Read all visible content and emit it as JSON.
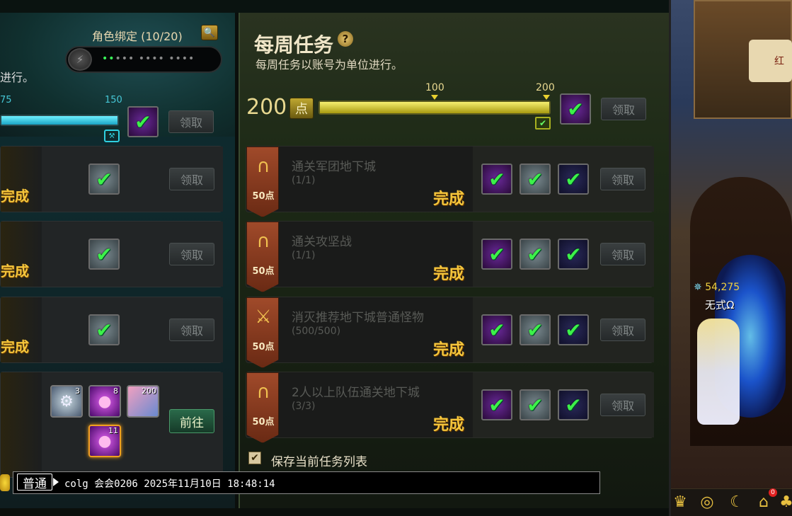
{
  "left": {
    "char_bind_label": "角色绑定 (10/20)",
    "pwd_masked": "••• •••• ••••",
    "pwd_active_dots": "••",
    "desc_fragment": "进行。",
    "tick_75": "75",
    "tick_150": "150",
    "progress": 1.0,
    "claim_label": "领取",
    "go_label": "前往",
    "done_label": "完成",
    "items": [
      {
        "count": "3",
        "icon": "gear-shield-icon"
      },
      {
        "count": "8",
        "icon": "purple-orb-icon"
      },
      {
        "count": "200",
        "icon": "ticket-icon"
      },
      {
        "count": "11",
        "icon": "purple-orb-icon"
      }
    ]
  },
  "right": {
    "title": "每周任务",
    "subtitle": "每周任务以账号为单位进行。",
    "points_value": "200",
    "points_unit": "点",
    "tick_100": "100",
    "tick_200": "200",
    "progress": 1.0,
    "claim_label": "领取",
    "save_label": "保存当前任务列表",
    "tasks": [
      {
        "name": "通关军团地下城",
        "progress": "(1/1)",
        "points": "50点",
        "status": "完成",
        "icon": "arch-icon"
      },
      {
        "name": "通关攻坚战",
        "progress": "(1/1)",
        "points": "50点",
        "status": "完成",
        "icon": "arch-icon"
      },
      {
        "name": "消灭推荐地下城普通怪物",
        "progress": "(500/500)",
        "points": "50点",
        "status": "完成",
        "icon": "sword-icon"
      },
      {
        "name": "2人以上队伍通关地下城",
        "progress": "(3/3)",
        "points": "50点",
        "status": "完成",
        "icon": "arch-icon"
      }
    ]
  },
  "chat": {
    "mode": "普通",
    "text": "colg 会会0206 2025年11月10日 18:48:14"
  },
  "scene": {
    "sign_text": "红",
    "char_power": "54,275",
    "char_name": "无式Ω",
    "hud_badge": "0"
  },
  "colors": {
    "done": "#f5c63c",
    "check": "#3cf24a",
    "weekly_bar": "#f6f070",
    "left_bar": "#6ef0ff"
  }
}
